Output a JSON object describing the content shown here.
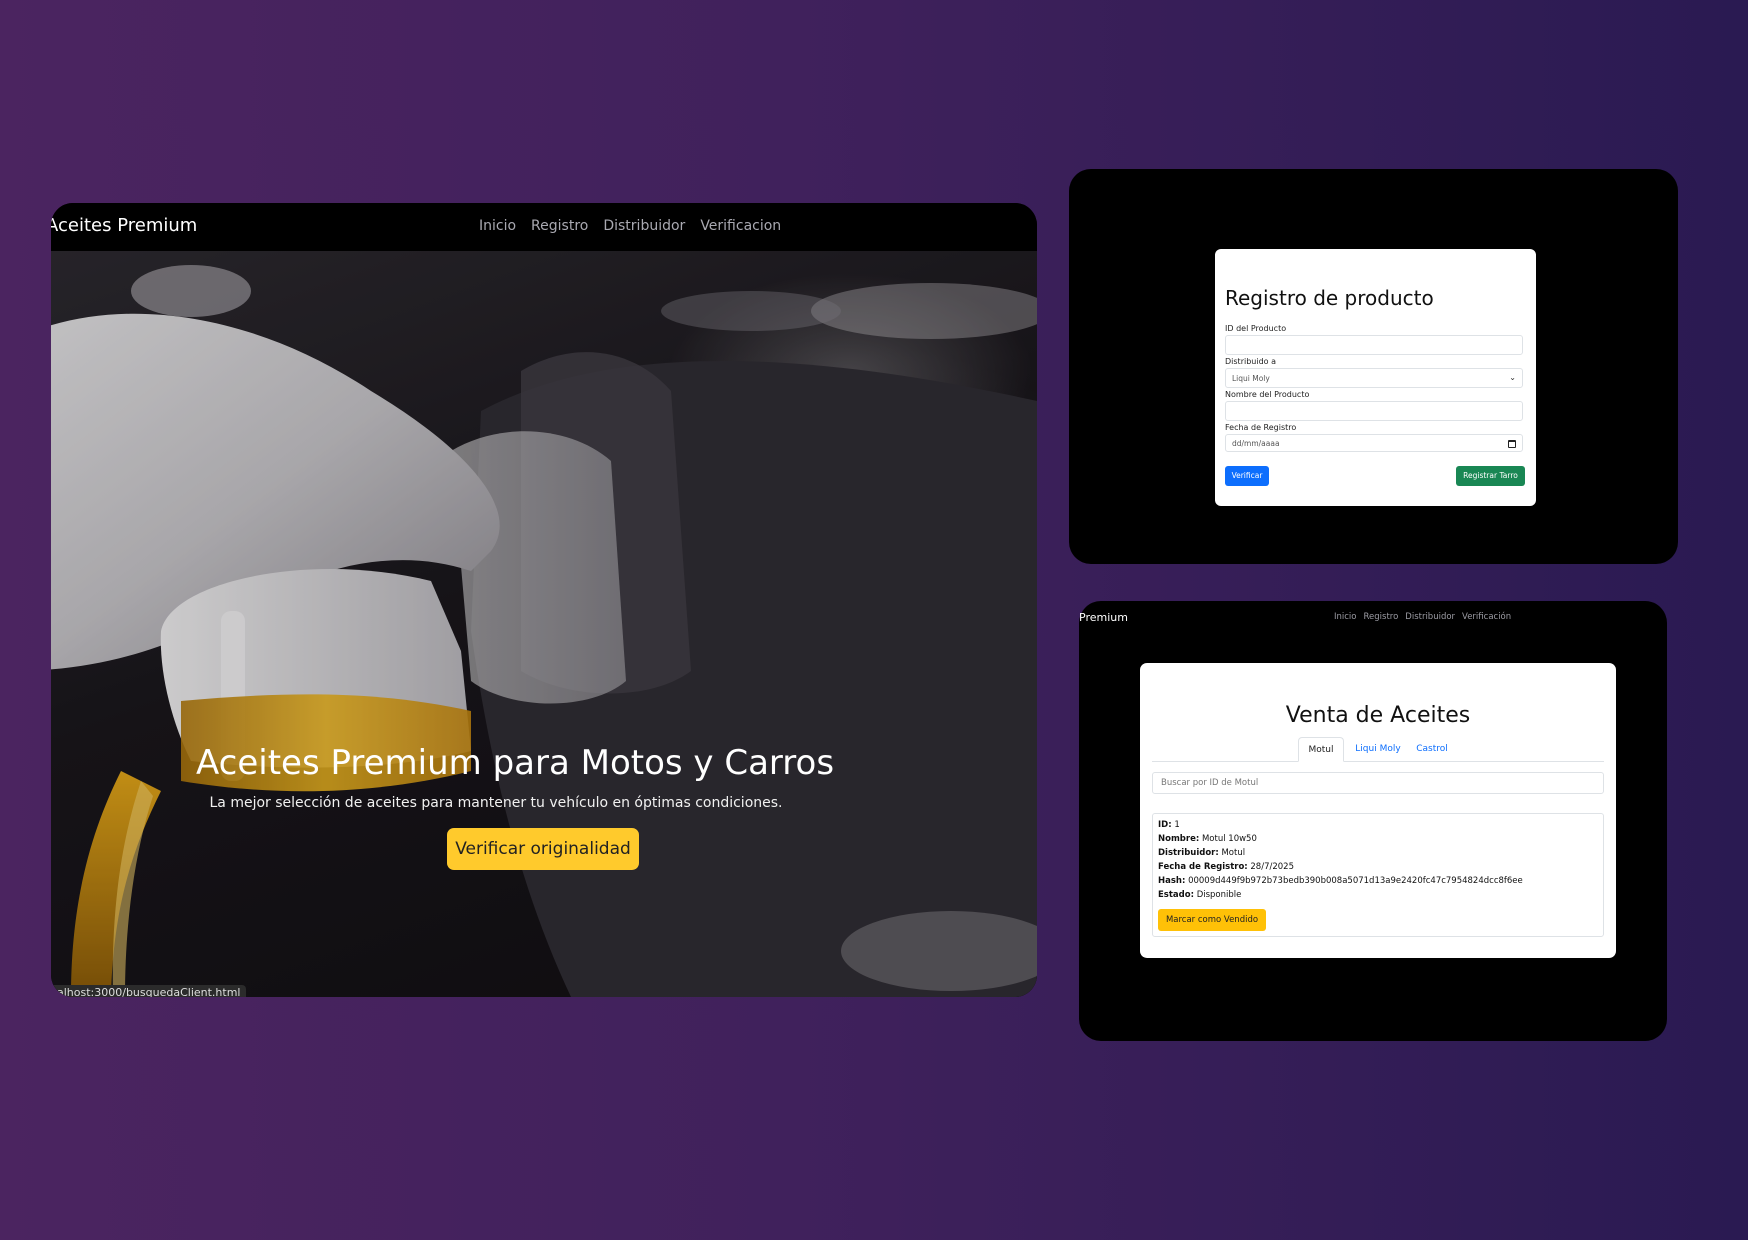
{
  "landing": {
    "brand": "Aceites Premium",
    "nav": [
      "Inicio",
      "Registro",
      "Distribuidor",
      "Verificacion"
    ],
    "hero_title": "Aceites Premium para Motos y Carros",
    "hero_subtitle": "La mejor selección de aceites para mantener tu vehículo en óptimas condiciones.",
    "cta_label": "Verificar originalidad",
    "status_url": "alhost:3000/busquedaClient.html",
    "accent_color": "#ffca2c"
  },
  "registro": {
    "title": "Registro de producto",
    "fields": {
      "id_label": "ID del Producto",
      "id_value": "",
      "distribuido_label": "Distribuido a",
      "distribuido_value": "Liqui Moly",
      "nombre_label": "Nombre del Producto",
      "nombre_value": "",
      "fecha_label": "Fecha de Registro",
      "fecha_placeholder": "dd/mm/aaaa"
    },
    "buttons": {
      "verificar": "Verificar",
      "registrar": "Registrar Tarro"
    },
    "colors": {
      "primary": "#0d6efd",
      "success": "#198754"
    }
  },
  "venta": {
    "brand": "Premium",
    "nav": [
      "Inicio",
      "Registro",
      "Distribuidor",
      "Verificación"
    ],
    "title": "Venta de Aceites",
    "tabs": [
      "Motul",
      "Liqui Moly",
      "Castrol"
    ],
    "active_tab": "Motul",
    "search_placeholder": "Buscar por ID de Motul",
    "result": {
      "id_label": "ID:",
      "id_value": "1",
      "nombre_label": "Nombre:",
      "nombre_value": "Motul 10w50",
      "distribuidor_label": "Distribuidor:",
      "distribuidor_value": "Motul",
      "fecha_label": "Fecha de Registro:",
      "fecha_value": "28/7/2025",
      "hash_label": "Hash:",
      "hash_value": "00009d449f9b972b73bedb390b008a5071d13a9e2420fc47c7954824dcc8f6ee",
      "estado_label": "Estado:",
      "estado_value": "Disponible"
    },
    "sold_button": "Marcar como Vendido",
    "warning_color": "#ffc107"
  }
}
